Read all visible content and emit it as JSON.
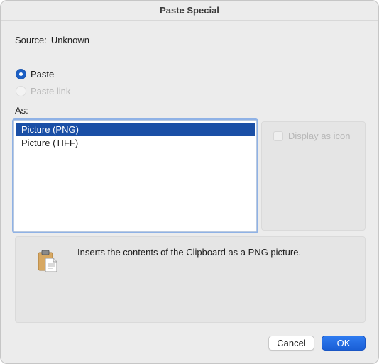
{
  "window": {
    "title": "Paste Special"
  },
  "source": {
    "label": "Source:",
    "value": "Unknown"
  },
  "options": {
    "paste_label": "Paste",
    "paste_selected": true,
    "paste_link_label": "Paste link",
    "paste_link_enabled": false
  },
  "as_section": {
    "label": "As:",
    "items": [
      {
        "label": "Picture (PNG)",
        "selected": true
      },
      {
        "label": "Picture (TIFF)",
        "selected": false
      }
    ]
  },
  "display_as_icon": {
    "label": "Display as icon",
    "checked": false,
    "enabled": false
  },
  "result": {
    "icon": "clipboard-icon",
    "text": "Inserts the contents of the Clipboard as a PNG picture."
  },
  "buttons": {
    "cancel_label": "Cancel",
    "ok_label": "OK"
  },
  "colors": {
    "accent": "#1c5fc4",
    "selection": "#1a4fa6",
    "default_button": "#1a5fd6"
  }
}
